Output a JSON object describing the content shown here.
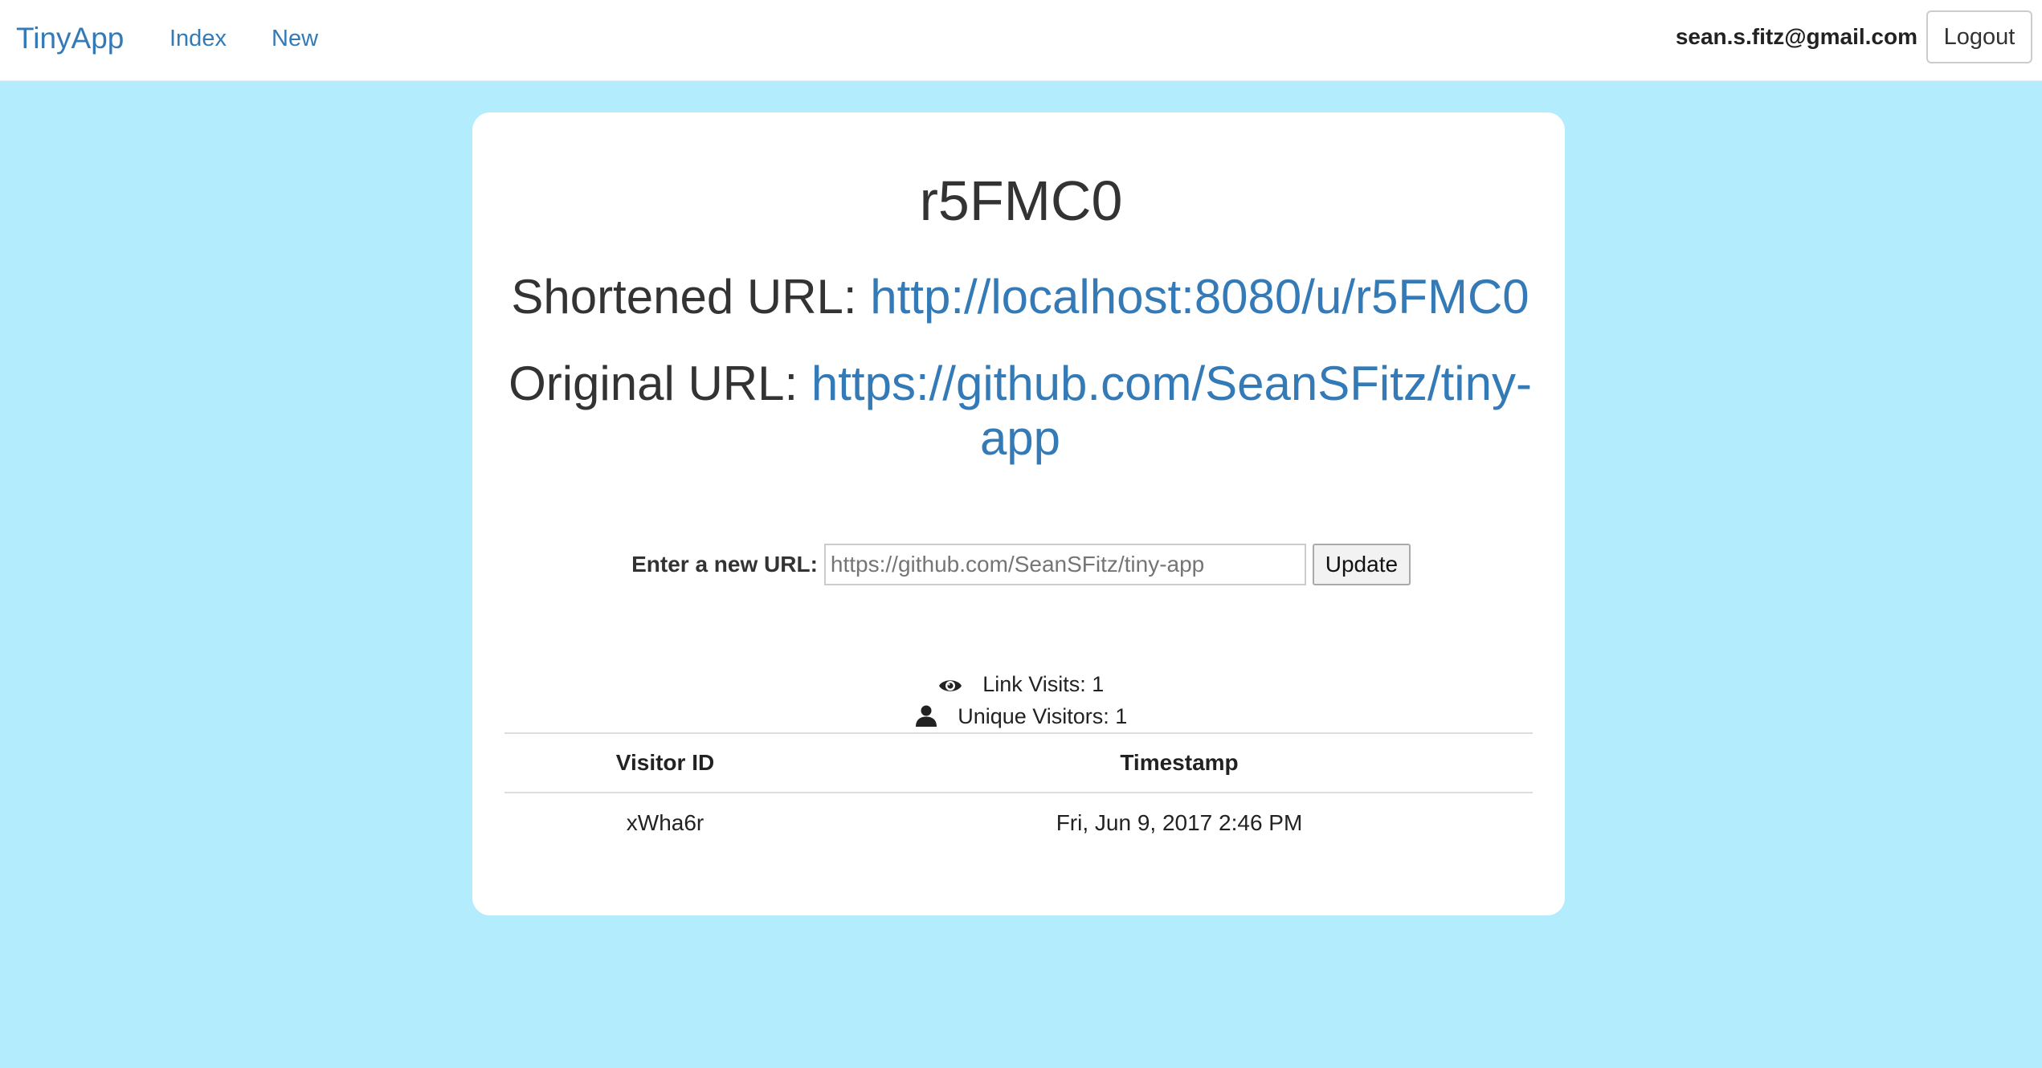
{
  "navbar": {
    "brand": "TinyApp",
    "links": [
      {
        "label": "Index"
      },
      {
        "label": "New"
      }
    ],
    "user_email": "sean.s.fitz@gmail.com",
    "logout_label": "Logout"
  },
  "url": {
    "id": "r5FMC0",
    "shortened_label": "Shortened URL:",
    "shortened_url": "http://localhost:8080/u/r5FMC0",
    "original_label": "Original URL:",
    "original_url": "https://github.com/SeanSFitz/tiny-app"
  },
  "update_form": {
    "label": "Enter a new URL:",
    "placeholder": "https://github.com/SeanSFitz/tiny-app",
    "value": "",
    "button_label": "Update"
  },
  "stats": {
    "link_visits": "Link Visits: 1",
    "unique_visitors": "Unique Visitors: 1"
  },
  "visits_table": {
    "headers": [
      "Visitor ID",
      "Timestamp"
    ],
    "rows": [
      [
        "xWha6r",
        "Fri, Jun 9, 2017 2:46 PM"
      ]
    ]
  },
  "colors": {
    "background": "#b3ecfd",
    "link": "#337ab7",
    "card": "#ffffff"
  },
  "icons": {
    "visits": "eye-icon",
    "unique": "user-icon"
  }
}
